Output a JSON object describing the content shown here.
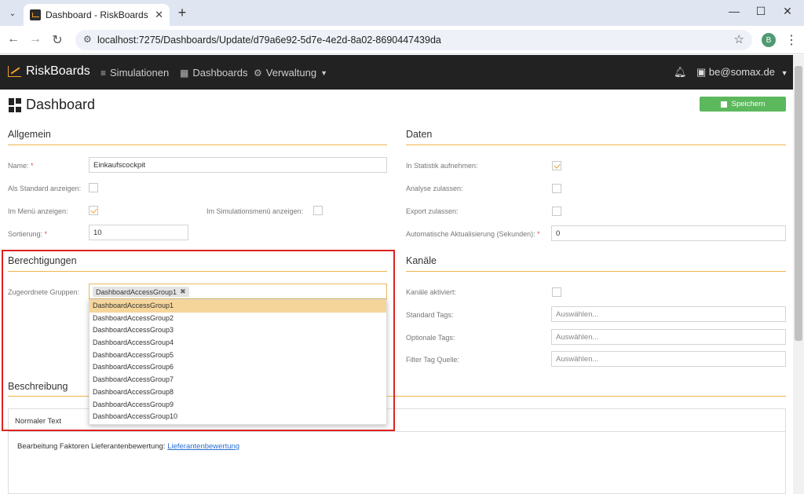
{
  "browser": {
    "tab_title": "Dashboard - RiskBoards",
    "url": "localhost:7275/Dashboards/Update/d79a6e92-5d7e-4e2d-8a02-8690447439da",
    "profile_initial": "B"
  },
  "navbar": {
    "brand": "RiskBoards",
    "items": [
      {
        "label": "Simulationen",
        "icon": "database-icon"
      },
      {
        "label": "Dashboards",
        "icon": "dashboard-icon"
      },
      {
        "label": "Verwaltung",
        "icon": "gear-icon"
      }
    ],
    "user": "be@somax.de"
  },
  "page": {
    "title": "Dashboard",
    "save_label": "Speichern"
  },
  "allgemein": {
    "title": "Allgemein",
    "name_label": "Name:",
    "name_value": "Einkaufscockpit",
    "standard_label": "Als Standard anzeigen:",
    "menu_label": "Im Menü anzeigen:",
    "simmenu_label": "Im Simulationsmenü anzeigen:",
    "sort_label": "Sortierung:",
    "sort_value": "10",
    "required_mark": "*"
  },
  "daten": {
    "title": "Daten",
    "statistik_label": "In Statistik aufnehmen:",
    "analyse_label": "Analyse zulassen:",
    "export_label": "Export zulassen:",
    "refresh_label": "Automatische Aktualisierung (Sekunden):",
    "refresh_value": "0"
  },
  "berechtigungen": {
    "title": "Berechtigungen",
    "groups_label": "Zugeordnete Gruppen:",
    "selected_tag": "DashboardAccessGroup1",
    "options": [
      "DashboardAccessGroup1",
      "DashboardAccessGroup2",
      "DashboardAccessGroup3",
      "DashboardAccessGroup4",
      "DashboardAccessGroup5",
      "DashboardAccessGroup6",
      "DashboardAccessGroup7",
      "DashboardAccessGroup8",
      "DashboardAccessGroup9",
      "DashboardAccessGroup10"
    ]
  },
  "kanaele": {
    "title": "Kanäle",
    "aktiviert_label": "Kanäle aktiviert:",
    "standard_tags_label": "Standard Tags:",
    "optionale_tags_label": "Optionale Tags:",
    "filter_label": "Filter Tag Quelle:",
    "placeholder": "Auswählen..."
  },
  "beschreibung": {
    "title": "Beschreibung",
    "format": "Normaler Text",
    "text": "Bearbeitung Faktoren Lieferantenbewertung:",
    "link": "Lieferantenbewertung"
  }
}
